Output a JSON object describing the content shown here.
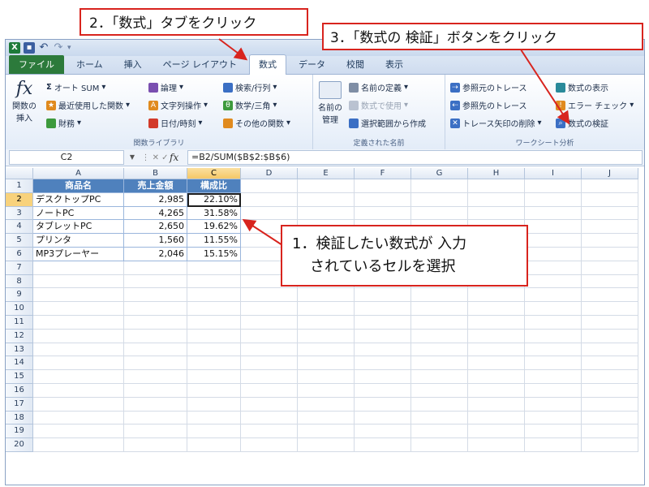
{
  "titlebar": {
    "excel_icon": "X"
  },
  "tabs": [
    "ファイル",
    "ホーム",
    "挿入",
    "ページ レイアウト",
    "数式",
    "データ",
    "校閲",
    "表示"
  ],
  "ribbon": {
    "insert_function": {
      "line1": "関数の",
      "line2": "挿入"
    },
    "autosum": "オート SUM",
    "recent": "最近使用した関数",
    "financial": "財務",
    "logical": "論理",
    "text": "文字列操作",
    "datetime": "日付/時刻",
    "lookup": "検索/行列",
    "math": "数学/三角",
    "more": "その他の関数",
    "group_library": "関数ライブラリ",
    "name_manager": {
      "line1": "名前の",
      "line2": "管理"
    },
    "define_name": "名前の定義",
    "use_in_formula": "数式で使用",
    "create_from_sel": "選択範囲から作成",
    "group_names": "定義された名前",
    "trace_precedents": "参照元のトレース",
    "trace_dependents": "参照先のトレース",
    "remove_arrows": "トレース矢印の削除",
    "show_formulas": "数式の表示",
    "error_check": "エラー チェック",
    "evaluate_formula": "数式の検証",
    "group_audit": "ワークシート分析"
  },
  "formula_bar": {
    "name_box": "C2",
    "fx": "fx",
    "formula": "=B2/SUM($B$2:$B$6)"
  },
  "columns": [
    "A",
    "B",
    "C",
    "D",
    "E",
    "F",
    "G",
    "H",
    "I",
    "J"
  ],
  "rows": [
    "1",
    "2",
    "3",
    "4",
    "5",
    "6",
    "7",
    "8",
    "9",
    "10",
    "11",
    "12",
    "13",
    "14",
    "15",
    "16",
    "17",
    "18",
    "19",
    "20"
  ],
  "table": {
    "headers": [
      "商品名",
      "売上金額",
      "構成比"
    ],
    "rows": [
      [
        "デスクトップPC",
        "2,985",
        "22.10%"
      ],
      [
        "ノートPC",
        "4,265",
        "31.58%"
      ],
      [
        "タブレットPC",
        "2,650",
        "19.62%"
      ],
      [
        "プリンタ",
        "1,560",
        "11.55%"
      ],
      [
        "MP3プレーヤー",
        "2,046",
        "15.15%"
      ]
    ]
  },
  "callouts": {
    "step1_line1": "1．検証したい数式が 入力",
    "step1_line2": "されているセルを選択",
    "step2": "2．「数式」タブをクリック",
    "step3": "3．「数式の 検証」ボタンをクリック"
  },
  "colors": {
    "accent_red": "#d8241e",
    "table_header": "#4f81bd",
    "file_tab": "#2c7a3b"
  }
}
